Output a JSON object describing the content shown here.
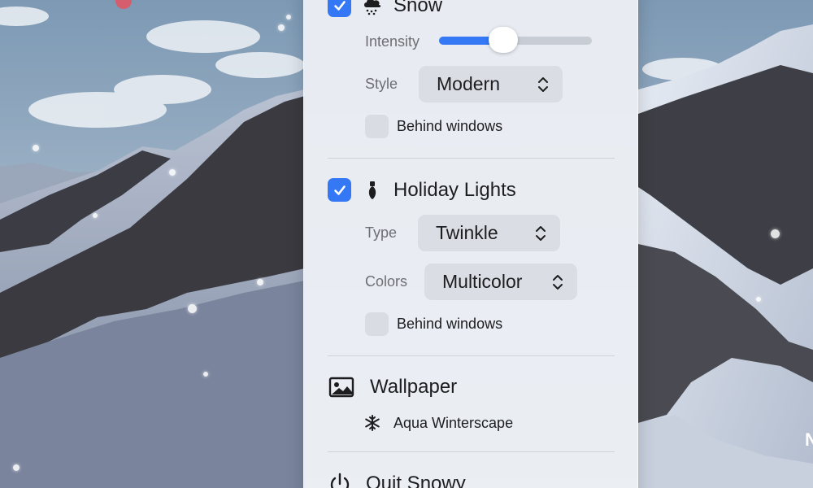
{
  "snow": {
    "title": "Snow",
    "enabled": true,
    "intensity_label": "Intensity",
    "intensity_level": 0.42,
    "style_label": "Style",
    "style_value": "Modern",
    "behind_windows_label": "Behind windows",
    "behind_windows_checked": false
  },
  "holiday_lights": {
    "title": "Holiday Lights",
    "enabled": true,
    "type_label": "Type",
    "type_value": "Twinkle",
    "colors_label": "Colors",
    "colors_value": "Multicolor",
    "behind_windows_label": "Behind windows",
    "behind_windows_checked": false
  },
  "wallpaper": {
    "title": "Wallpaper",
    "current": "Aqua Winterscape"
  },
  "quit": {
    "label": "Quit Snowy"
  },
  "edge_text": "N",
  "colors": {
    "accent": "#3478f6",
    "panel_bg": "#ebeef4",
    "popup_bg": "#dadde4"
  },
  "icons": [
    "snow-cloud-icon",
    "christmas-bulb-icon",
    "image-icon",
    "snowflake-icon",
    "power-icon",
    "checkmark-icon",
    "up-down-chevron-icon"
  ]
}
